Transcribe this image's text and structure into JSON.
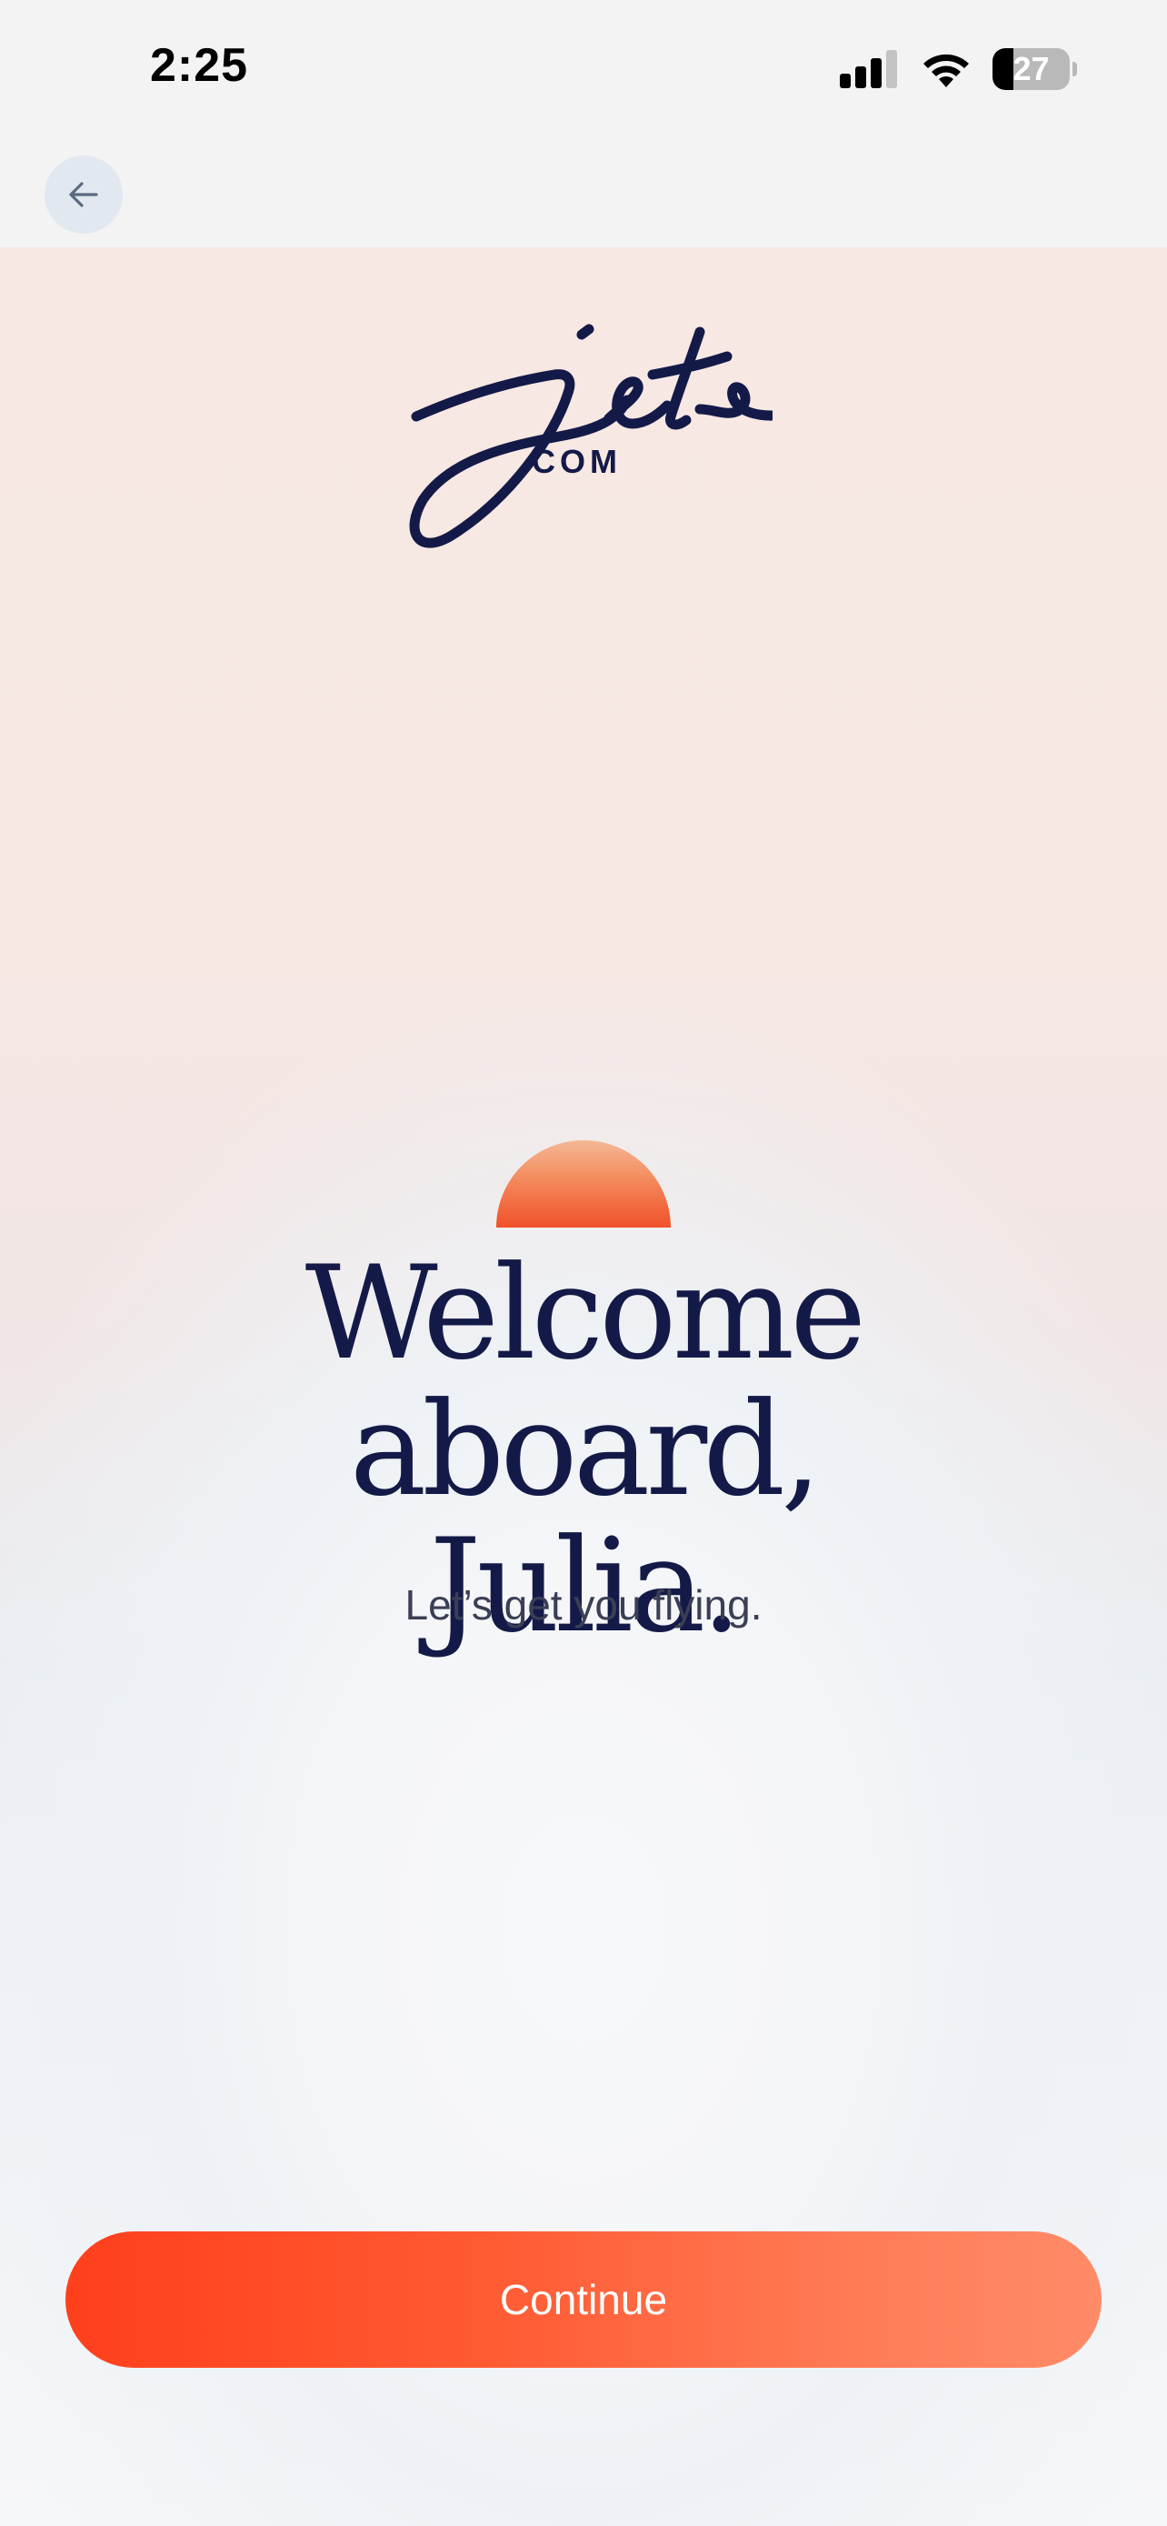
{
  "status_bar": {
    "time": "2:25",
    "battery_level": "27",
    "signal_icon": "cellular-signal-icon",
    "wifi_icon": "wifi-icon"
  },
  "nav": {
    "back_icon": "arrow-left-icon"
  },
  "brand": {
    "logo_script": "jets",
    "logo_suffix": ".COM",
    "color_navy": "#141a48",
    "color_accent": "#ff3f1c"
  },
  "welcome": {
    "title_line1": "Welcome aboard,",
    "title_line2": "Julia.",
    "subtitle": "Let’s get you flying.",
    "sun_icon": "sunrise-icon"
  },
  "actions": {
    "continue_label": "Continue"
  }
}
